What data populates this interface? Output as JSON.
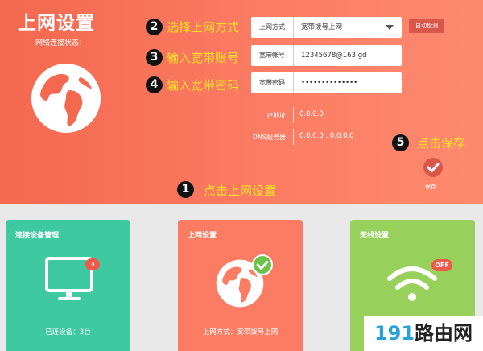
{
  "page": {
    "title": "上网设置",
    "status_label": "网络连接状态："
  },
  "steps": [
    {
      "number": "1",
      "text": "点击上网设置"
    },
    {
      "number": "2",
      "text": "选择上网方式"
    },
    {
      "number": "3",
      "text": "输入宽带账号"
    },
    {
      "number": "4",
      "text": "输入宽带密码"
    },
    {
      "number": "5",
      "text": "点击保存"
    }
  ],
  "form": {
    "mode": {
      "label": "上网方式",
      "value": "宽带拨号上网"
    },
    "detect_button": "自动检测",
    "account": {
      "label": "宽带帐号",
      "value": "12345678@163.gd"
    },
    "password": {
      "label": "宽带密码",
      "value": "••••••••••••••"
    }
  },
  "info": {
    "ip": {
      "label": "IP地址",
      "value": "0.0.0.0"
    },
    "dns": {
      "label": "DNS服务器",
      "value": "0.0.0.0 , 0.0.0.0"
    }
  },
  "save_label": "保存",
  "cards": {
    "devices": {
      "title": "连接设备管理",
      "badge": "3",
      "footer": "已连设备：3台"
    },
    "internet": {
      "title": "上网设置",
      "footer": "上网方式：宽带拨号上网"
    },
    "wireless": {
      "title": "无线设置",
      "badge": "OFF"
    }
  },
  "watermark": {
    "number": "191",
    "text": "路由网"
  },
  "colors": {
    "accent_red": "#f4684f",
    "step_yellow": "#ffe02a",
    "card_green": "#3ec9a0",
    "card_red": "#fb7c63",
    "card_lime": "#97d15b"
  },
  "icons": [
    "globe-icon",
    "check-icon",
    "monitor-icon",
    "wifi-icon"
  ]
}
